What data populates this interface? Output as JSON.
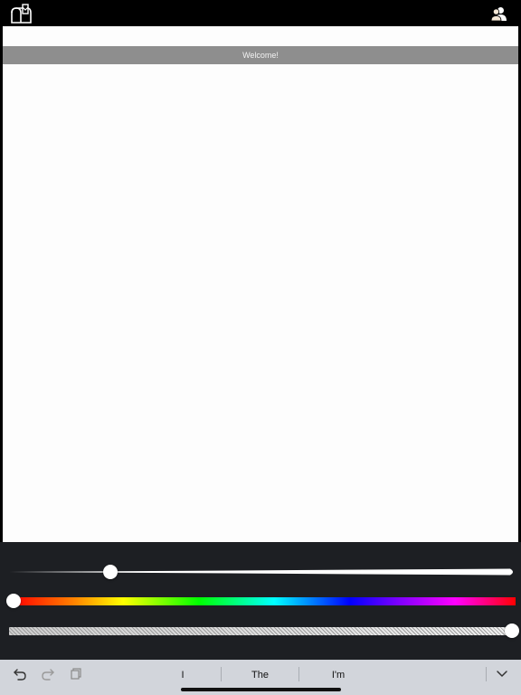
{
  "header": {
    "left_icon": "mailbox-icon",
    "right_icon": "contacts-icon"
  },
  "canvas": {
    "banner_text": "Welcome!"
  },
  "controls": {
    "brush_size": {
      "value": 0.2
    },
    "hue": {
      "value": 0.0
    },
    "opacity": {
      "value": 1.0
    }
  },
  "keyboard_bar": {
    "tools": [
      "undo-icon",
      "redo-icon",
      "paste-icon"
    ],
    "suggestions": [
      "I",
      "The",
      "I'm"
    ],
    "dismiss_icon": "chevron-down-icon"
  },
  "colors": {
    "topbar": "#000000",
    "canvas_background": "#fdfdfd",
    "banner": "#8e8e8e",
    "controls_background": "#1d1f23",
    "keyboard_bar": "#d2d5db"
  }
}
